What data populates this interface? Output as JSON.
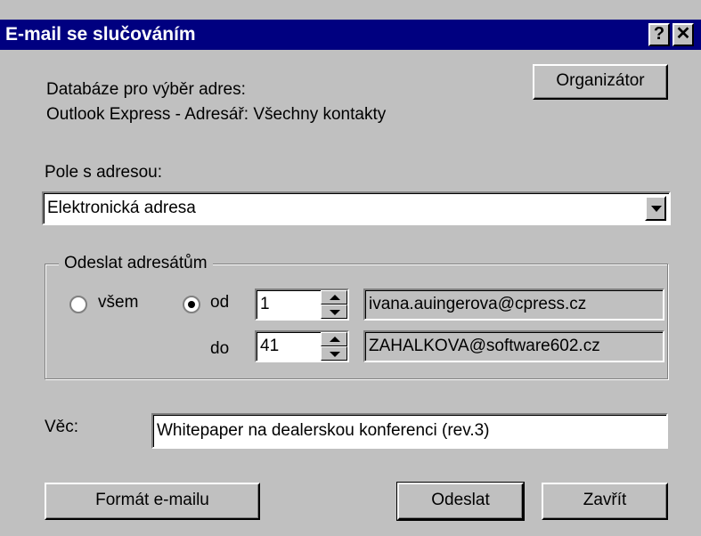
{
  "window": {
    "title": "E-mail se slučováním",
    "help_glyph": "?",
    "close_glyph": "✕"
  },
  "database": {
    "label": "Databáze pro výběr adres:",
    "source": "Outlook Express - Adresář: Všechny kontakty",
    "organizer_button": "Organizátor"
  },
  "address_field": {
    "label": "Pole s adresou:",
    "selected": "Elektronická adresa"
  },
  "recipients": {
    "group_title": "Odeslat adresátům",
    "all_label": "všem",
    "from_label": "od",
    "to_label": "do",
    "selected_option": "od",
    "from_value": "1",
    "to_value": "41",
    "from_email": "ivana.auingerova@cpress.cz",
    "to_email": "ZAHALKOVA@software602.cz"
  },
  "subject": {
    "label": "Věc:",
    "value": "Whitepaper na dealerskou konferenci (rev.3)"
  },
  "buttons": {
    "format": "Formát e-mailu",
    "send": "Odeslat",
    "close": "Zavřít"
  }
}
